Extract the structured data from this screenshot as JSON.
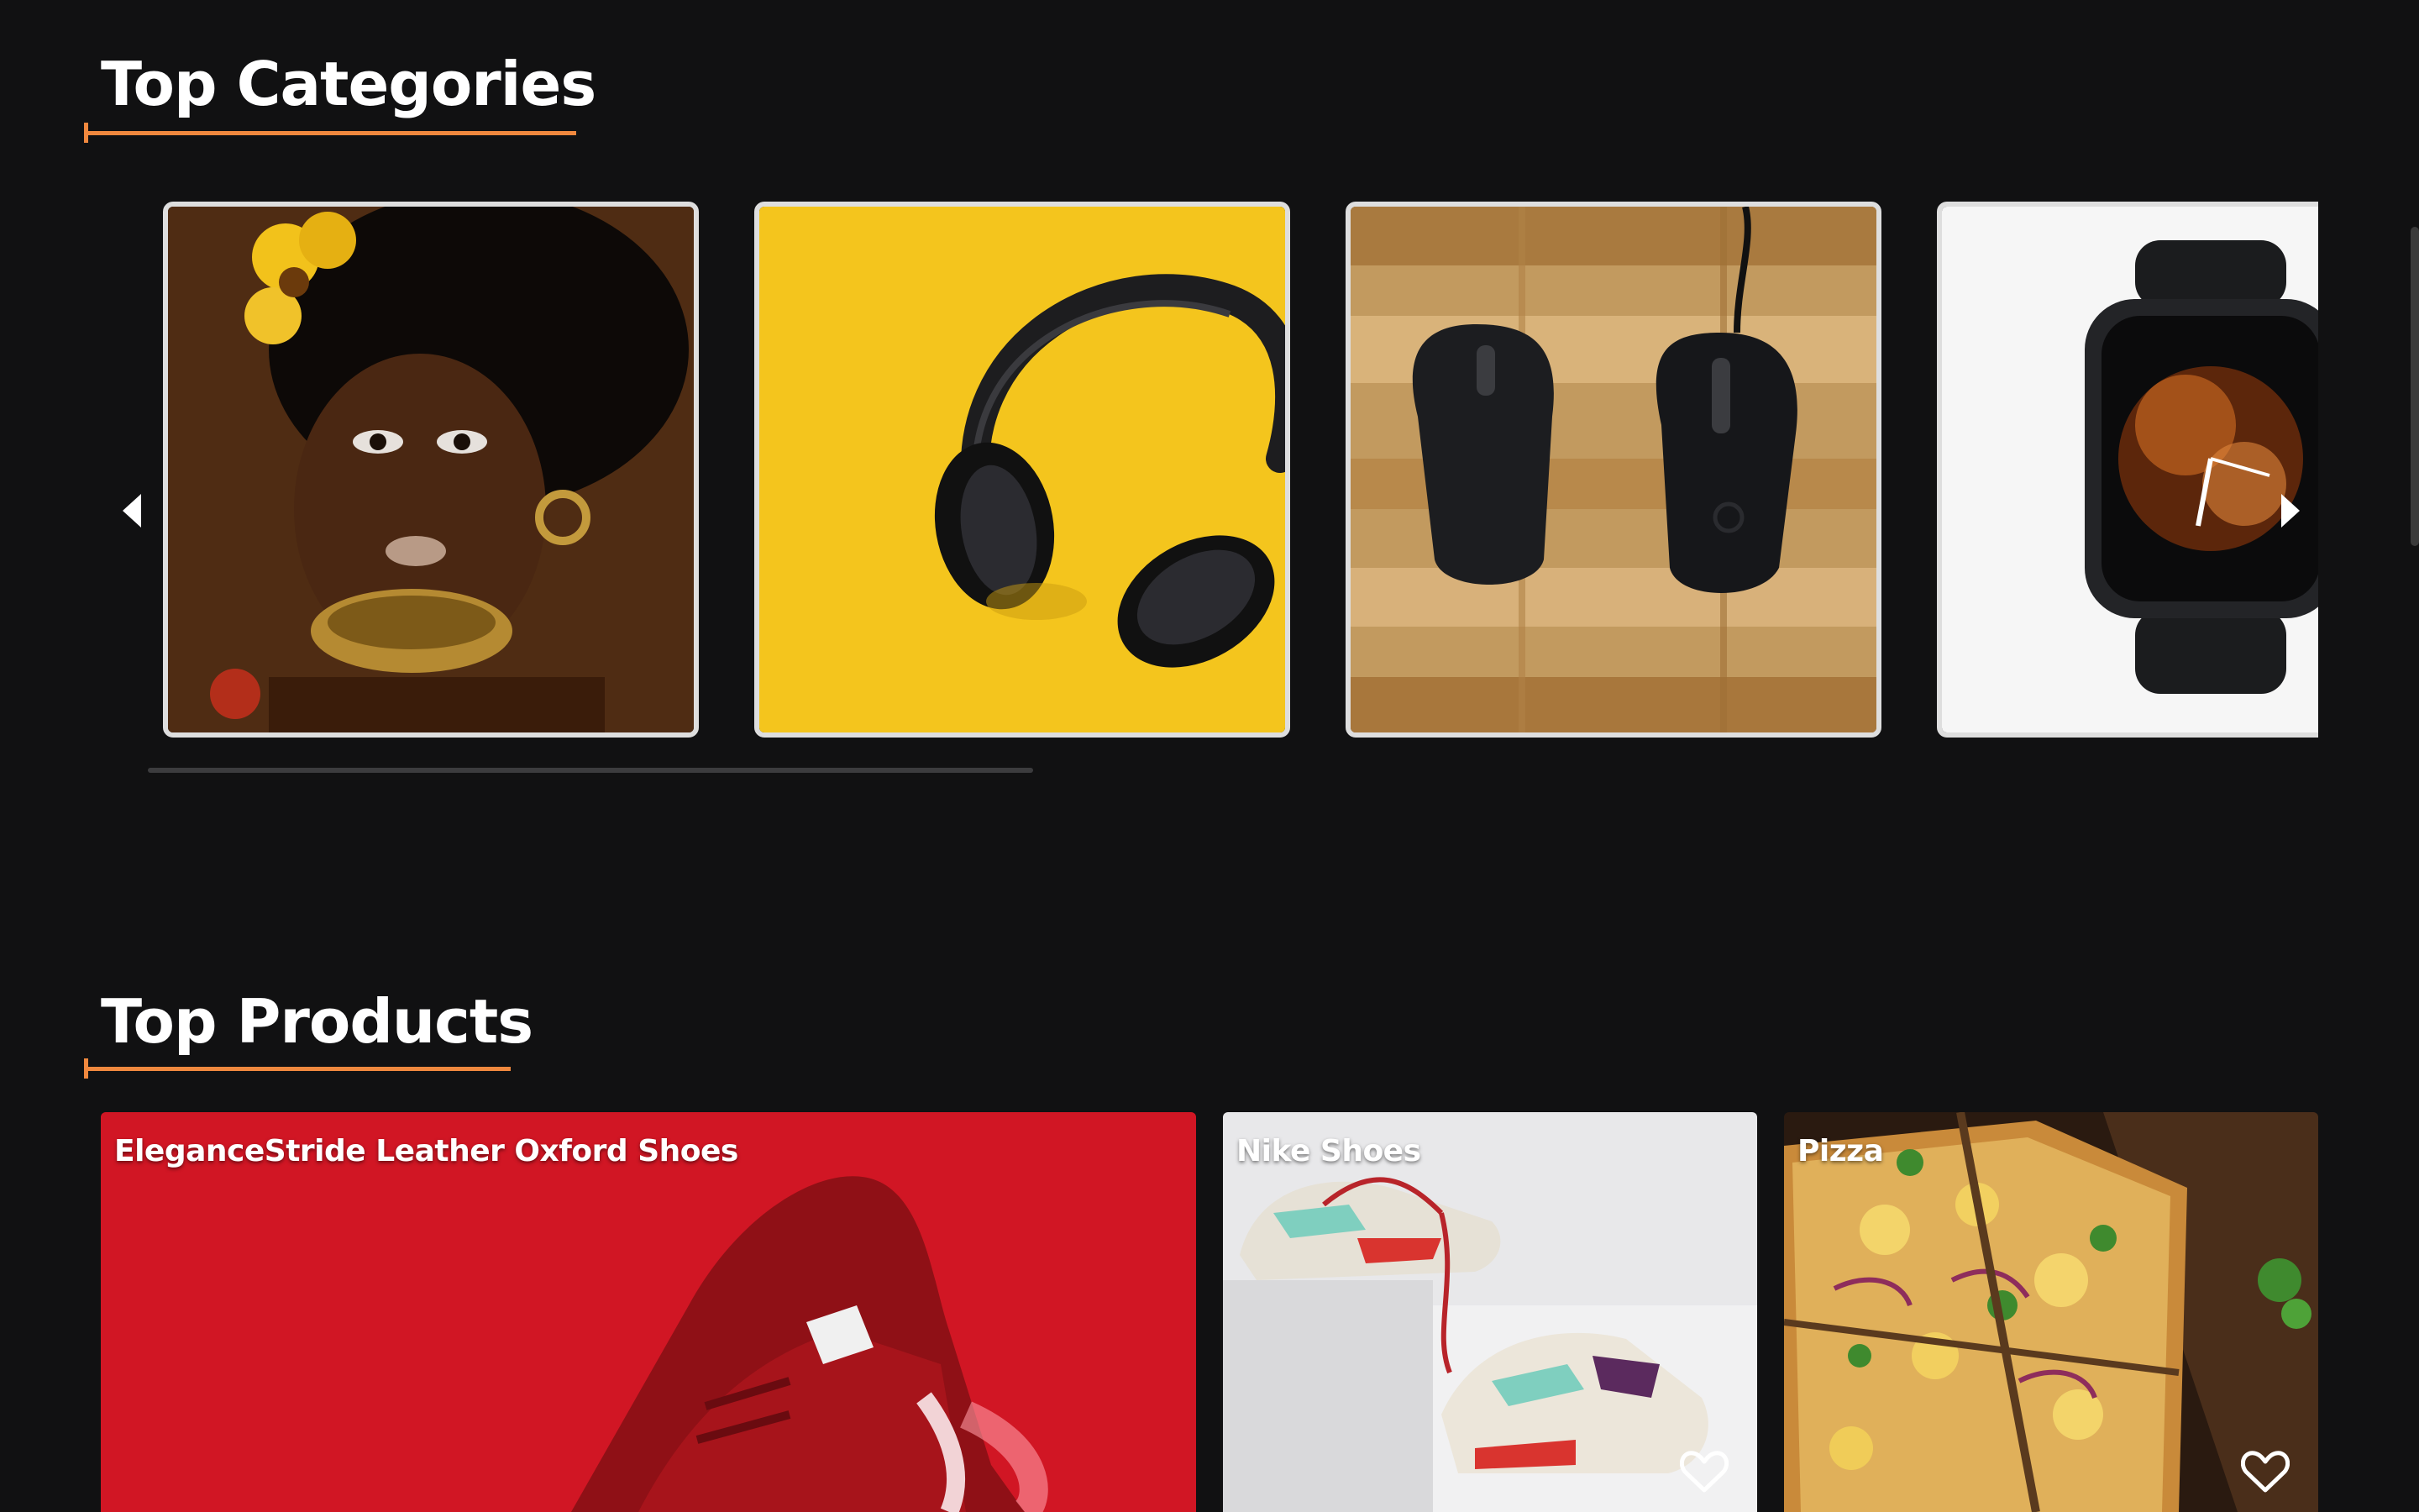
{
  "sections": {
    "categories_title": "Top Categories",
    "products_title": "Top Products"
  },
  "categories": [
    {
      "name": "category-card-fashion",
      "image": "woman-portrait"
    },
    {
      "name": "category-card-audio",
      "image": "headphones"
    },
    {
      "name": "category-card-accessories",
      "image": "computer-mice"
    },
    {
      "name": "category-card-watches",
      "image": "smartwatch"
    }
  ],
  "products": [
    {
      "name": "EleganceStride Leather Oxford Shoes"
    },
    {
      "name": "Nike Shoes"
    },
    {
      "name": "Pizza"
    }
  ],
  "icons": {
    "prev": "chevron-left-icon",
    "next": "chevron-right-icon",
    "favorite": "heart-icon"
  },
  "colors": {
    "background": "#111112",
    "accent": "#f0883e",
    "card_border": "#dedede"
  }
}
